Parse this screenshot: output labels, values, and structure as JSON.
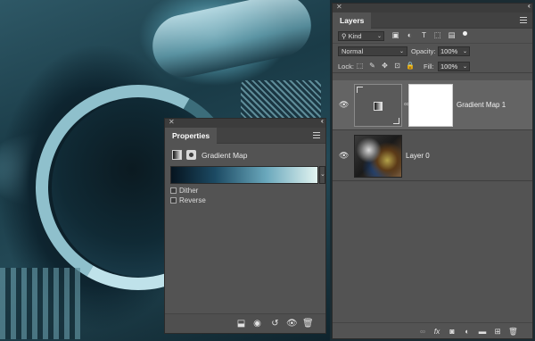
{
  "properties_panel": {
    "tab": "Properties",
    "title": "Gradient Map",
    "options": [
      {
        "label": "Dither"
      },
      {
        "label": "Reverse"
      }
    ],
    "footer_icons": [
      "clip-to-layer-icon",
      "view-previous-state-icon",
      "reset-icon",
      "visibility-icon",
      "delete-icon"
    ]
  },
  "layers_panel": {
    "tab": "Layers",
    "kind_filter": "Kind",
    "blend_mode": "Normal",
    "opacity_label": "Opacity:",
    "opacity_value": "100%",
    "lock_label": "Lock:",
    "fill_label": "Fill:",
    "fill_value": "100%",
    "layers": [
      {
        "name": "Gradient Map 1",
        "type": "adjustment",
        "selected": true,
        "visible": true
      },
      {
        "name": "Layer 0",
        "type": "photo",
        "selected": false,
        "visible": true
      }
    ],
    "footer_icons": [
      "link-layers-icon",
      "fx-icon",
      "add-mask-icon",
      "new-adjustment-icon",
      "new-group-icon",
      "new-layer-icon",
      "trash-icon"
    ]
  },
  "colors": {
    "panel_bg": "#535353",
    "selected_row": "#646464",
    "gradient_start": "#06141f",
    "gradient_end": "#e3f4f1"
  }
}
